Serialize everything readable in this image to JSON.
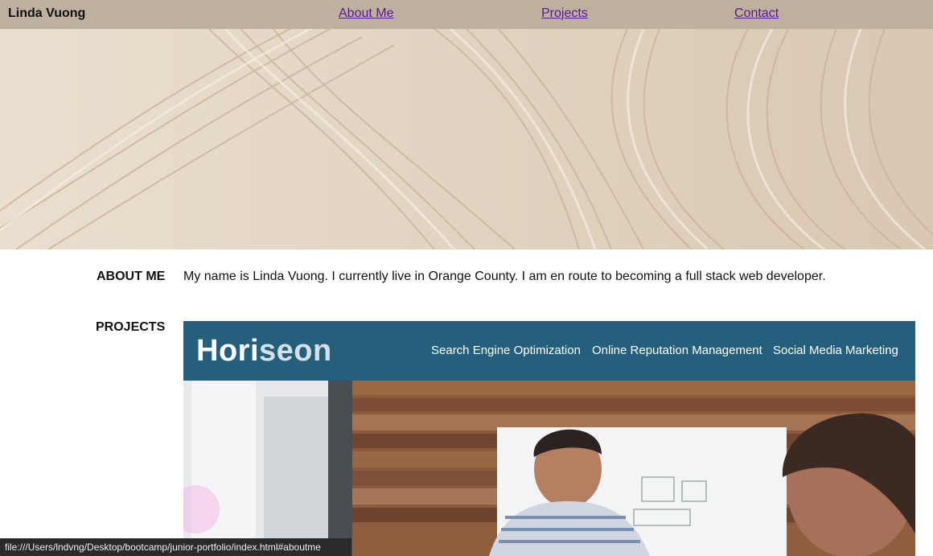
{
  "header": {
    "brand": "Linda Vuong",
    "nav": [
      {
        "label": "About Me"
      },
      {
        "label": "Projects"
      },
      {
        "label": "Contact"
      }
    ]
  },
  "about": {
    "heading": "ABOUT ME",
    "text": "My name is Linda Vuong. I currently live in Orange County. I am en route to becoming a full stack web developer."
  },
  "projects": {
    "heading": "PROJECTS",
    "card": {
      "logo_part1": "Hori",
      "logo_part2": "seon",
      "nav": [
        "Search Engine Optimization",
        "Online Reputation Management",
        "Social Media Marketing"
      ]
    }
  },
  "status": {
    "url": "file:///Users/lndvng/Desktop/bootcamp/junior-portfolio/index.html#aboutme"
  },
  "colors": {
    "header_bg": "#bdb09c",
    "horiseon_bar": "#24607c",
    "link": "#5a1a8c"
  }
}
